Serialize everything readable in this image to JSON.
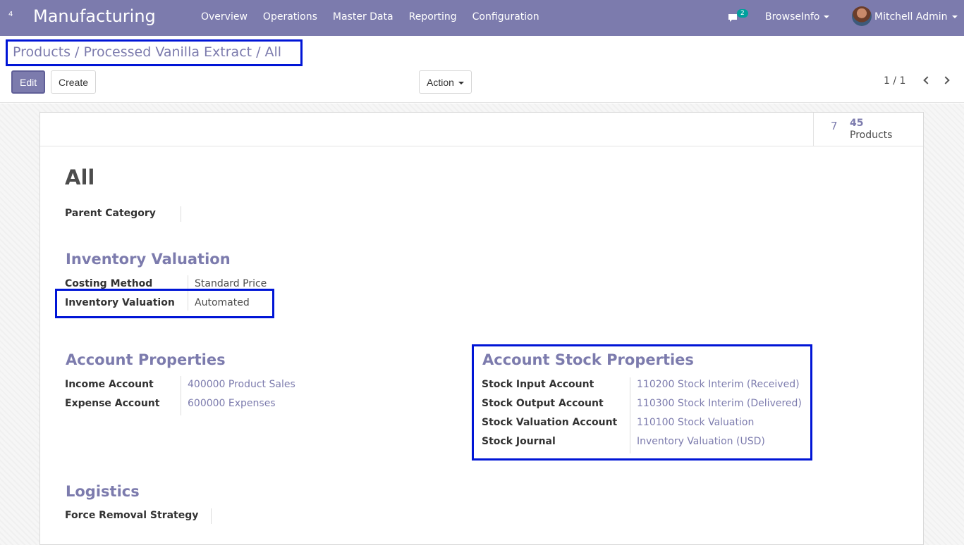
{
  "navbar": {
    "apps_badge": "4",
    "app_title": "Manufacturing",
    "menu": [
      "Overview",
      "Operations",
      "Master Data",
      "Reporting",
      "Configuration"
    ],
    "chat_count": "2",
    "company": "BrowseInfo",
    "user": "Mitchell Admin"
  },
  "breadcrumb": {
    "items": [
      "Products",
      "Processed Vanilla Extract"
    ],
    "separator": "/",
    "current": "All"
  },
  "controls": {
    "edit": "Edit",
    "create": "Create",
    "action": "Action",
    "pager": "1 / 1"
  },
  "stat": {
    "icon": "7",
    "value": "45",
    "label": "Products"
  },
  "record": {
    "title": "All",
    "parent_category_label": "Parent Category",
    "parent_category_value": ""
  },
  "inventory_valuation": {
    "title": "Inventory Valuation",
    "costing_method_label": "Costing Method",
    "costing_method_value": "Standard Price",
    "valuation_label": "Inventory Valuation",
    "valuation_value": "Automated"
  },
  "account_properties": {
    "title": "Account Properties",
    "income_label": "Income Account",
    "income_value": "400000 Product Sales",
    "expense_label": "Expense Account",
    "expense_value": "600000 Expenses"
  },
  "account_stock_properties": {
    "title": "Account Stock Properties",
    "input_label": "Stock Input Account",
    "input_value": "110200 Stock Interim (Received)",
    "output_label": "Stock Output Account",
    "output_value": "110300 Stock Interim (Delivered)",
    "valuation_label": "Stock Valuation Account",
    "valuation_value": "110100 Stock Valuation",
    "journal_label": "Stock Journal",
    "journal_value": "Inventory Valuation (USD)"
  },
  "logistics": {
    "title": "Logistics",
    "removal_label": "Force Removal Strategy",
    "removal_value": ""
  },
  "colors": {
    "brand": "#7c7bad",
    "highlight": "#0015d6",
    "chat_badge": "#00a09d"
  }
}
